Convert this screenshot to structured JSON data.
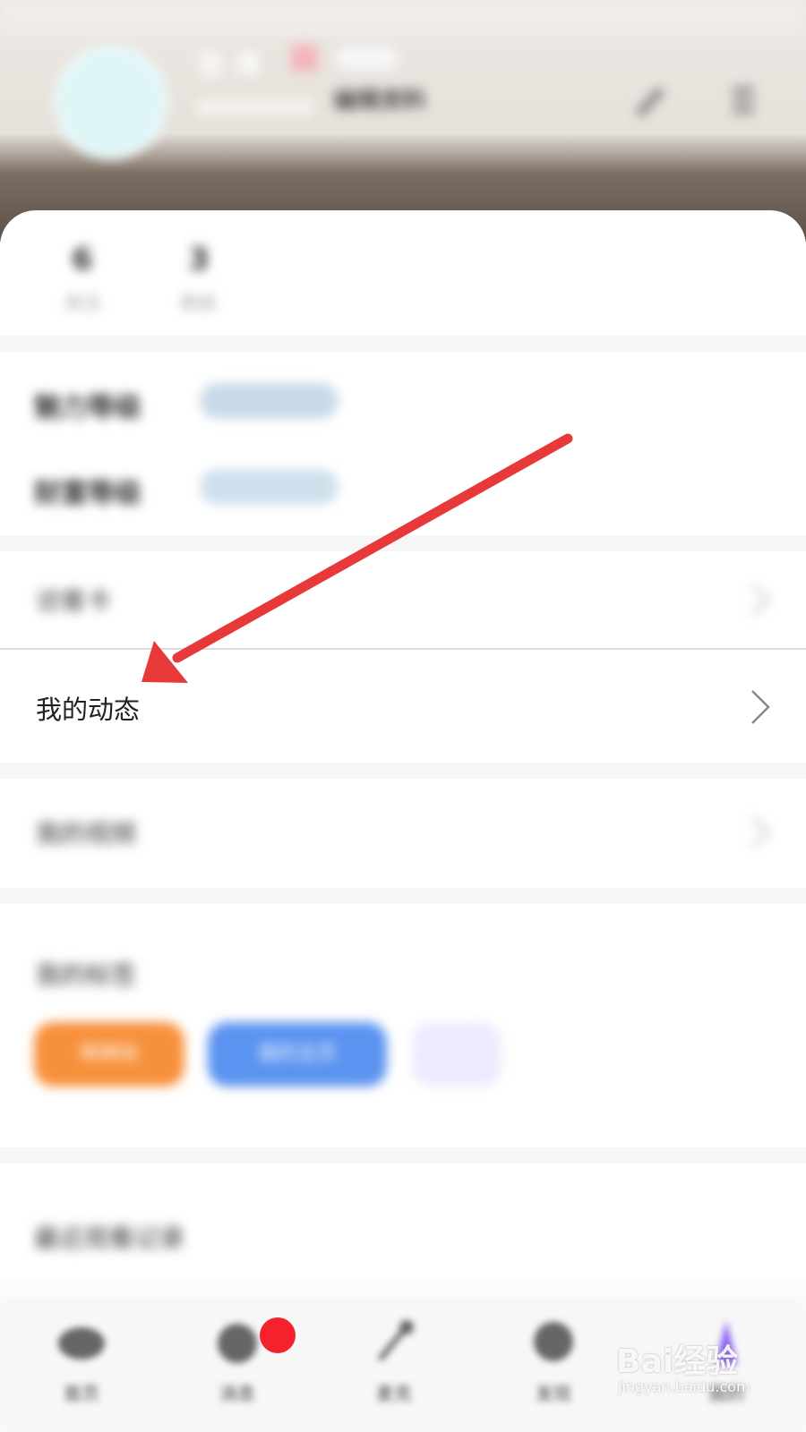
{
  "header": {
    "user_name": "张 涛",
    "edit_profile_label": "编辑资料"
  },
  "stats": [
    {
      "value": "6",
      "label": "关注"
    },
    {
      "value": "3",
      "label": "粉丝"
    }
  ],
  "grades": {
    "experience_label": "魅力等级",
    "wealth_label": "财富等级"
  },
  "menu": {
    "visitor_label": "访客卡",
    "my_dynamics_label": "我的动态",
    "my_works_label": "我的视频"
  },
  "tags": {
    "title": "我的标签",
    "items": [
      {
        "label": "萌萌哒",
        "color": "#f7903a"
      },
      {
        "label": "我的主页",
        "color": "#5b93f0"
      },
      {
        "label": "",
        "color": "#ecebff"
      }
    ]
  },
  "history": {
    "title": "最近观看记录"
  },
  "bottom_nav": [
    {
      "label": "首页",
      "icon": "home-icon"
    },
    {
      "label": "消息",
      "icon": "message-icon"
    },
    {
      "label": "麦克",
      "icon": "mic-icon"
    },
    {
      "label": "发现",
      "icon": "discover-icon"
    },
    {
      "label": "我的",
      "icon": "profile-icon"
    }
  ],
  "watermark": {
    "brand": "Bai经验",
    "url": "jingyan.baidu.com"
  },
  "colors": {
    "arrow": "#e8393a",
    "badge_red": "#f5222d"
  }
}
